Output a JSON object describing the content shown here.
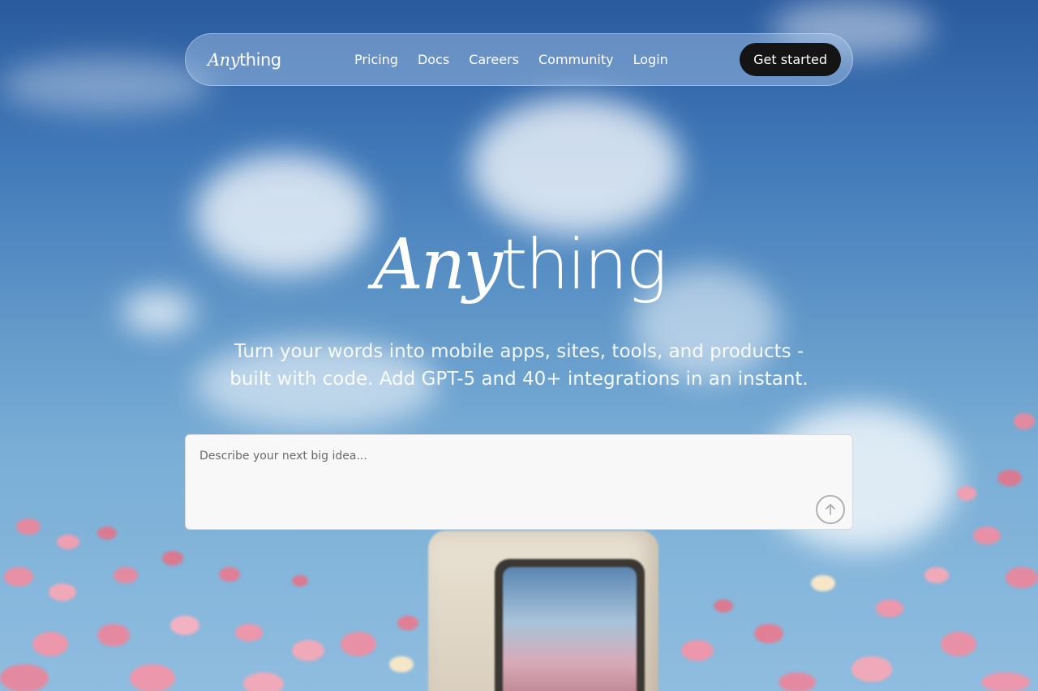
{
  "nav": {
    "brand": {
      "italic": "Any",
      "rest": "thing"
    },
    "links": [
      "Pricing",
      "Docs",
      "Careers",
      "Community",
      "Login"
    ],
    "cta": "Get started"
  },
  "hero": {
    "logo": {
      "italic": "Any",
      "rest": "thing"
    },
    "tagline": "Turn your words into mobile apps, sites, tools, and products - built with code. Add GPT-5 and 40+ integrations in an instant."
  },
  "prompt": {
    "placeholder": "Describe your next big idea...",
    "submit_icon": "arrow-up-icon"
  }
}
